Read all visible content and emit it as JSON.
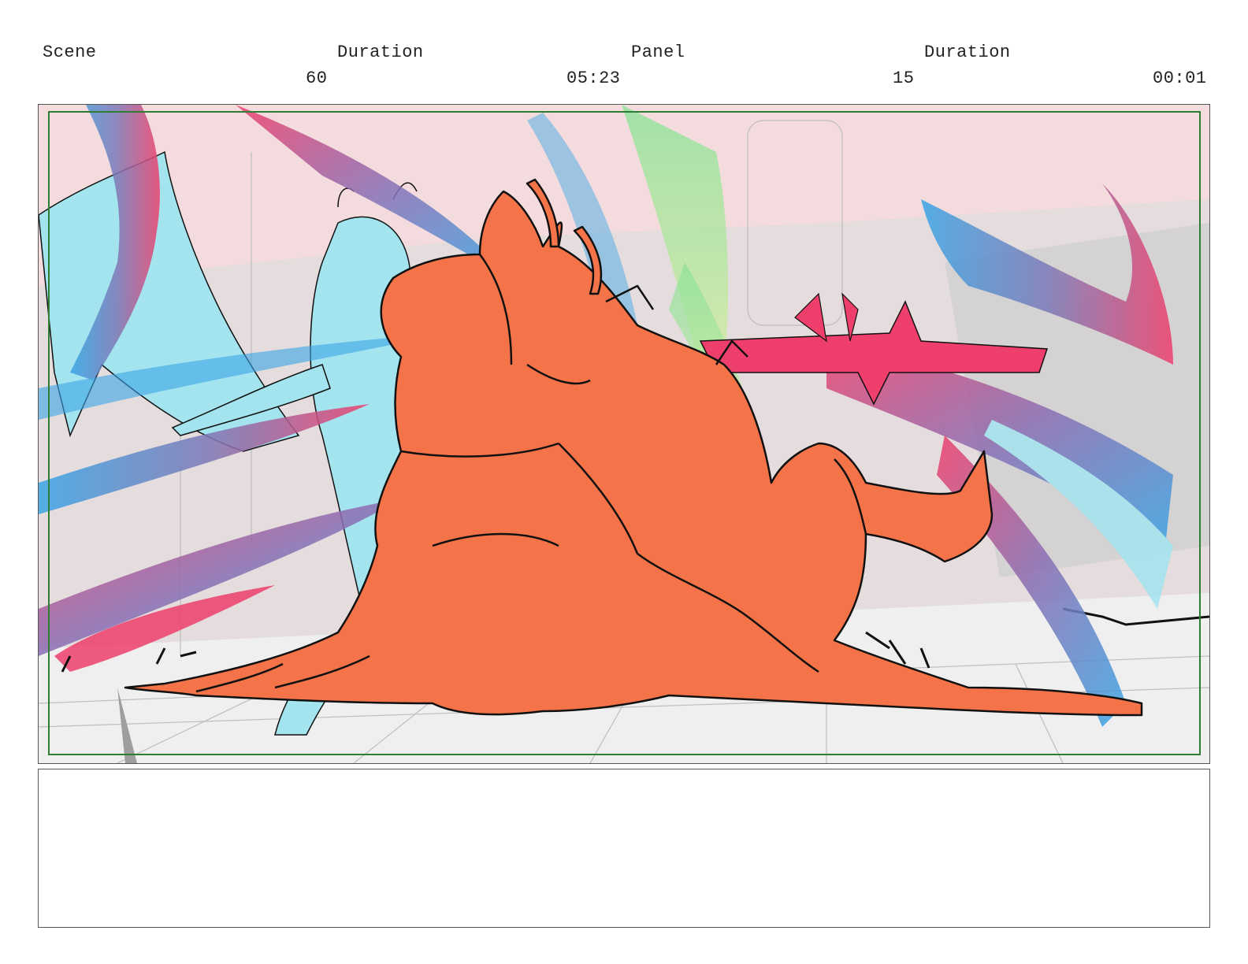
{
  "header": {
    "scene_label": "Scene",
    "duration_label_1": "Duration",
    "panel_label": "Panel",
    "duration_label_2": "Duration",
    "scene_value": "60",
    "scene_duration": "05:23",
    "panel_value": "15",
    "panel_duration": "00:01"
  },
  "colors": {
    "character_fill": "#f47349",
    "ghost_fill": "#a3e4ef",
    "background": "#f4dcde",
    "safe_area": "#2e7d32",
    "streak_red": "#ee3f6c",
    "streak_blue": "#3aa5e6"
  },
  "notes": {
    "text": ""
  }
}
